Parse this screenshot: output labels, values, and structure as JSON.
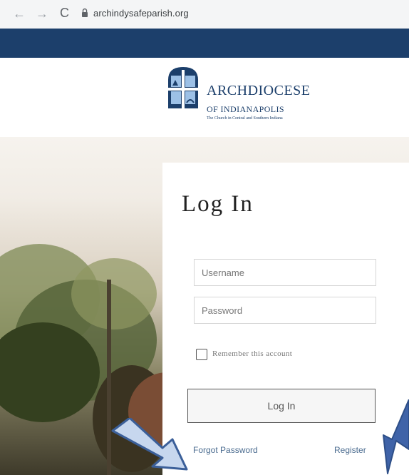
{
  "browser": {
    "url": "archindysafeparish.org",
    "back_glyph": "←",
    "forward_glyph": "→",
    "reload_glyph": "C"
  },
  "logo": {
    "title": "ARCHDIOCESE",
    "subtitle": "OF INDIANAPOLIS",
    "tagline": "The Church in Central and Southern Indiana"
  },
  "login": {
    "heading": "Log In",
    "username_placeholder": "Username",
    "password_placeholder": "Password",
    "remember_label": "Remember this account",
    "submit_label": "Log In",
    "forgot_label": "Forgot Password",
    "register_label": "Register"
  },
  "colors": {
    "nav_bar": "#1c3f6b",
    "logo": "#1c3f6b",
    "link": "#4a6b8f",
    "arrow_fill": "#c7d7ee",
    "arrow_stroke": "#3b5f99"
  }
}
